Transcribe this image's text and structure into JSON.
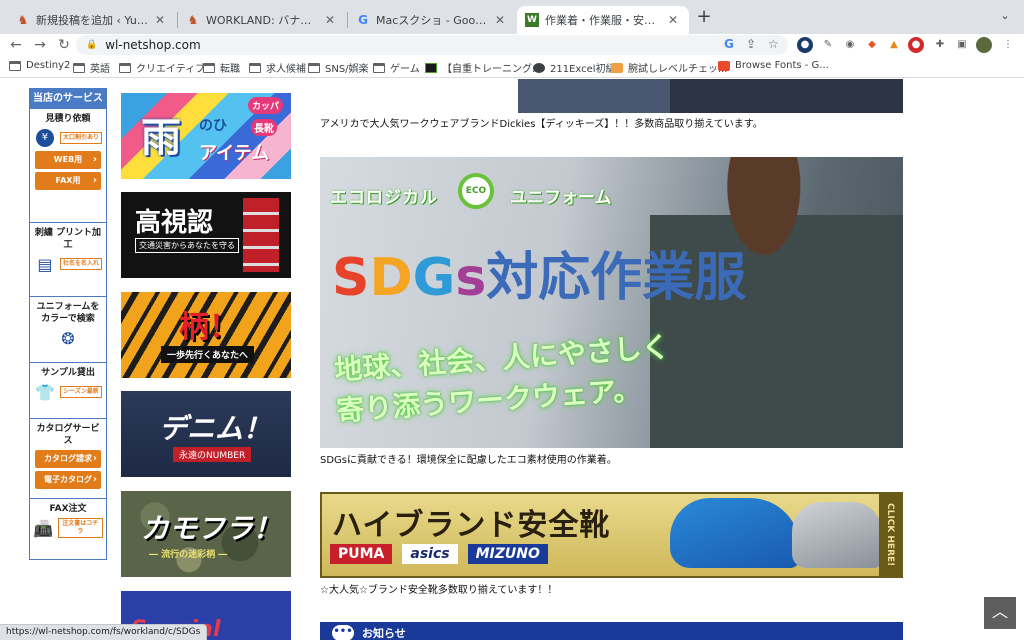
{
  "browser": {
    "tabs": [
      {
        "title": "新規投稿を追加 ‹ Yutaka Ronald",
        "favicon": "horse-icon",
        "active": false
      },
      {
        "title": "WORKLAND: バナー③ – Yutaka",
        "favicon": "horse-icon",
        "active": false
      },
      {
        "title": "Macスクショ - Google 検索",
        "favicon": "google-icon",
        "active": false
      },
      {
        "title": "作業着・作業服・安全靴の通販なら",
        "favicon": "workland-icon",
        "active": true
      }
    ],
    "new_tab": "+",
    "url": "wl-netshop.com",
    "bookmarks": [
      {
        "label": "Destiny2",
        "type": "folder"
      },
      {
        "label": "英語",
        "type": "folder"
      },
      {
        "label": "クリエイティブ",
        "type": "folder"
      },
      {
        "label": "転職",
        "type": "folder"
      },
      {
        "label": "求人候補",
        "type": "folder"
      },
      {
        "label": "SNS/娯楽",
        "type": "folder"
      },
      {
        "label": "ゲーム",
        "type": "folder"
      },
      {
        "label": "【自重トレーニング...",
        "type": "site"
      },
      {
        "label": "211Excel初級",
        "type": "site"
      },
      {
        "label": "腕試しレベルチェッ...",
        "type": "site"
      },
      {
        "label": "Browse Fonts - G...",
        "type": "site"
      }
    ],
    "status_url": "https://wl-netshop.com/fs/workland/c/SDGs"
  },
  "sidebar": {
    "title": "当店のサービス",
    "sections": [
      {
        "title": "見積り依頼",
        "tag": "大口割引あり",
        "icon": "yen-bag-icon",
        "buttons": [
          "WEB用",
          "FAX用"
        ]
      },
      {
        "title": "刺繍 プリント加工",
        "tag": "社名を名入れ",
        "icon": "embroidery-icon",
        "buttons": []
      },
      {
        "title": "ユニフォームを カラーで検索",
        "tag": "",
        "icon": "color-circles-icon",
        "buttons": []
      },
      {
        "title": "サンプル貸出",
        "tag": "シーズン最新",
        "icon": "shirt-icon",
        "buttons": []
      },
      {
        "title": "カタログサービス",
        "tag": "",
        "icon": "",
        "buttons": [
          "カタログ請求",
          "電子カタログ"
        ]
      },
      {
        "title": "FAX注文",
        "tag": "注文書はコチラ",
        "icon": "fax-icon",
        "buttons": []
      }
    ]
  },
  "banners": {
    "ame": {
      "cap": "カッパ",
      "big": "雨",
      "sm": "のひ",
      "sm2": "アイテム",
      "boots": "長靴"
    },
    "koushinin": {
      "big": "高視認",
      "sub": "交通災害からあなたを守る"
    },
    "gara": {
      "big": "柄！",
      "sub": "一歩先行くあなたへ"
    },
    "denim": {
      "big": "デニム！",
      "sub": "永遠のNUMBER"
    },
    "camo": {
      "big": "カモフラ！",
      "sub": "― 流行の迷彩柄 ―"
    },
    "special": {
      "big": "Special Goods"
    }
  },
  "main": {
    "caption_dickies": "アメリカで大人気ワークウェアブランドDickies【ディッキーズ】！！多数商品取り揃えています。",
    "sdgs": {
      "eco": "エコロジカル",
      "uni": "ユニフォーム",
      "cycle": "ECO",
      "title_sdgs": [
        "S",
        "D",
        "G",
        "s"
      ],
      "title_rest": "対応作業服",
      "line1": "地球、社会、人にやさしく",
      "line2": "寄り添うワークウェア。"
    },
    "caption_sdgs": "SDGsに貢献できる！環境保全に配慮したエコ素材使用の作業着。",
    "shoes": {
      "title": "ハイブランド安全靴",
      "brands": [
        "PUMA",
        "asics",
        "MIZUNO"
      ],
      "click": "CLICK HERE!"
    },
    "caption_shoes": "☆大人気☆ブランド安全靴多数取り揃えています！！",
    "notice": "お知らせ"
  },
  "colors": {
    "sidebar_blue": "#4a7bc4",
    "accent_orange": "#e27c1a",
    "notice_blue": "#1a3a9a"
  }
}
